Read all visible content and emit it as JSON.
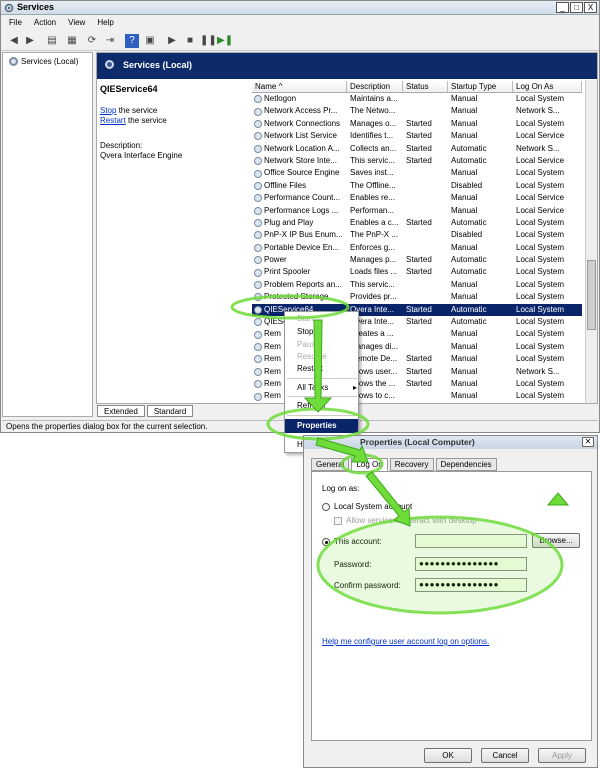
{
  "window": {
    "title": "Services",
    "controls": [
      "_",
      "□",
      "X"
    ]
  },
  "menu": [
    "File",
    "Action",
    "View",
    "Help"
  ],
  "tree": {
    "item": "Services (Local)"
  },
  "header": {
    "title": "Services (Local)"
  },
  "detail": {
    "name": "QIEService64",
    "stop_link": "Stop",
    "stop_rest": " the service",
    "restart_link": "Restart",
    "restart_rest": " the service",
    "desc_label": "Description:",
    "desc_value": "Qvera Interface Engine"
  },
  "columns": [
    "Name",
    "Description",
    "Status",
    "Startup Type",
    "Log On As"
  ],
  "rows": [
    [
      "Netlogon",
      "Maintains a...",
      "",
      "Manual",
      "Local System"
    ],
    [
      "Network Access Pr...",
      "The Netwo...",
      "",
      "Manual",
      "Network S..."
    ],
    [
      "Network Connections",
      "Manages o...",
      "Started",
      "Manual",
      "Local System"
    ],
    [
      "Network List Service",
      "Identifies t...",
      "Started",
      "Manual",
      "Local Service"
    ],
    [
      "Network Location A...",
      "Collects an...",
      "Started",
      "Automatic",
      "Network S..."
    ],
    [
      "Network Store Inte...",
      "This servic...",
      "Started",
      "Automatic",
      "Local Service"
    ],
    [
      "Office Source Engine",
      "Saves inst...",
      "",
      "Manual",
      "Local System"
    ],
    [
      "Offline Files",
      "The Offline...",
      "",
      "Disabled",
      "Local System"
    ],
    [
      "Performance Count...",
      "Enables re...",
      "",
      "Manual",
      "Local Service"
    ],
    [
      "Performance Logs ...",
      "Performan...",
      "",
      "Manual",
      "Local Service"
    ],
    [
      "Plug and Play",
      "Enables a c...",
      "Started",
      "Automatic",
      "Local System"
    ],
    [
      "PnP-X IP Bus Enum...",
      "The PnP-X ...",
      "",
      "Disabled",
      "Local System"
    ],
    [
      "Portable Device En...",
      "Enforces g...",
      "",
      "Manual",
      "Local System"
    ],
    [
      "Power",
      "Manages p...",
      "Started",
      "Automatic",
      "Local System"
    ],
    [
      "Print Spooler",
      "Loads files ...",
      "Started",
      "Automatic",
      "Local System"
    ],
    [
      "Problem Reports an...",
      "This servic...",
      "",
      "Manual",
      "Local System"
    ],
    [
      "Protected Storage",
      "Provides pr...",
      "",
      "Manual",
      "Local System"
    ],
    [
      "QIEService64",
      "Qvera Inte...",
      "Started",
      "Automatic",
      "Local System"
    ],
    [
      "QIEService32",
      "Qvera Inte...",
      "Started",
      "Automatic",
      "Local System"
    ],
    [
      "Rem",
      "Creates a ...",
      "",
      "Manual",
      "Local System"
    ],
    [
      "Rem",
      "Manages di...",
      "",
      "Manual",
      "Local System"
    ],
    [
      "Rem",
      "Remote De...",
      "Started",
      "Manual",
      "Local System"
    ],
    [
      "Rem",
      "Allows user...",
      "Started",
      "Manual",
      "Network S..."
    ],
    [
      "Rem",
      "Allows the ...",
      "Started",
      "Manual",
      "Local System"
    ],
    [
      "Rem",
      "Allows to c...",
      "",
      "Manual",
      "Local System"
    ]
  ],
  "selected_row": 17,
  "tabs": [
    "Extended",
    "Standard"
  ],
  "status": "Opens the properties dialog box for the current selection.",
  "context_menu": {
    "start": "Start",
    "stop": "Stop",
    "pause": "Pause",
    "resume": "Resume",
    "restart": "Restart",
    "all_tasks": "All Tasks",
    "refresh": "Refresh",
    "properties": "Properties",
    "help": "Help"
  },
  "dialog": {
    "title": "Properties (Local Computer)",
    "tabs": [
      "General",
      "Log On",
      "Recovery",
      "Dependencies"
    ],
    "logon_as": "Log on as:",
    "local_system": "Local System account",
    "allow_desktop": "Allow service to interact with desktop",
    "this_account": "This account:",
    "password_label": "Password:",
    "confirm_label": "Confirm password:",
    "password_value": "●●●●●●●●●●●●●●●",
    "confirm_value": "●●●●●●●●●●●●●●●",
    "browse": "Browse...",
    "help_link": "Help me configure user account log on options.",
    "ok": "OK",
    "cancel": "Cancel",
    "apply": "Apply"
  },
  "colors": {
    "selection": "#0a246a",
    "annotation": "#6fdc3a"
  }
}
